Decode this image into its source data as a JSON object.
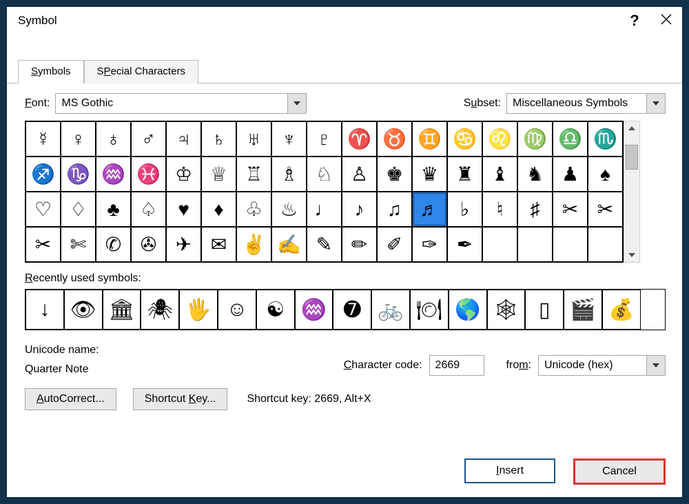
{
  "window": {
    "title": "Symbol"
  },
  "tabs": [
    {
      "label": "Symbols",
      "hotkey": "S"
    },
    {
      "label": "Special Characters",
      "hotkey": "P"
    }
  ],
  "font_label": "Font:",
  "font_value": "MS Gothic",
  "subset_label": "Subset:",
  "subset_value": "Miscellaneous Symbols",
  "grid": {
    "selected_index": 45,
    "chars": [
      "☿",
      "♀",
      "♁",
      "♂",
      "♃",
      "♄",
      "♅",
      "♆",
      "♇",
      "♈",
      "♉",
      "♊",
      "♋",
      "♌",
      "♍",
      "♎",
      "♏",
      "♐",
      "♑",
      "♒",
      "♓",
      "♔",
      "♕",
      "♖",
      "♗",
      "♘",
      "♙",
      "♚",
      "♛",
      "♜",
      "♝",
      "♞",
      "♟",
      "♠",
      "♡",
      "♢",
      "♣",
      "♤",
      "♥",
      "♦",
      "♧",
      "♨",
      "♩",
      "♪",
      "♫",
      "♬",
      "♭",
      "♮",
      "♯",
      "✂",
      "✂",
      "✂",
      "✄",
      "✆",
      "✇",
      "✈",
      "✉",
      "✌",
      "✍",
      "✎",
      "✏",
      "✐",
      "✑",
      "✒",
      "",
      "",
      "",
      ""
    ]
  },
  "recent_label": "Recently used symbols:",
  "recent": [
    "↓",
    "👁",
    "🏛",
    "🕷",
    "🖐",
    "☺",
    "☯",
    "♒",
    "➐",
    "🚲",
    "🍽",
    "🌎",
    "🕸",
    "▯",
    "🎬",
    "💰"
  ],
  "meta": {
    "unicode_name_label": "Unicode name:",
    "unicode_name_value": "Quarter Note",
    "char_code_label": "Character code:",
    "char_code_value": "2669",
    "from_label": "from:",
    "from_value": "Unicode (hex)"
  },
  "buttons": {
    "autocorrect": "AutoCorrect...",
    "shortcut": "Shortcut Key...",
    "shortcut_info_label": "Shortcut key:",
    "shortcut_info_value": "2669, Alt+X",
    "insert": "Insert",
    "cancel": "Cancel"
  }
}
